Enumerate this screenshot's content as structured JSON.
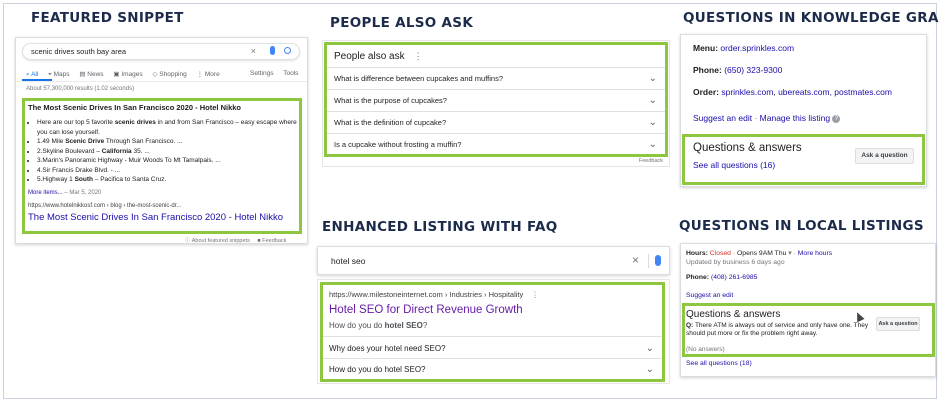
{
  "headings": {
    "featured": "FEATURED SNIPPET",
    "paa": "PEOPLE ALSO ASK",
    "kg": "QUESTIONS IN KNOWLEDGE GRAPH",
    "faq": "ENHANCED LISTING WITH FAQ",
    "local": "QUESTIONS IN LOCAL LISTINGS"
  },
  "featured": {
    "query": "scenic drives south bay area",
    "tabs": [
      "All",
      "Maps",
      "News",
      "Images",
      "Shopping",
      "More"
    ],
    "tools": [
      "Settings",
      "Tools"
    ],
    "results_count": "About 57,300,000 results (1.02 seconds)",
    "snippet_title": "The Most Scenic Drives In San Francisco 2020 - Hotel Nikko",
    "intro": "Here are our top 5 favorite scenic drives in and from San Francisco – easy escape where you can lose yourself.",
    "items": [
      "1.49 Mile Scenic Drive Through San Francisco. ...",
      "2.Skyline Boulevard – California 35. ...",
      "3.Marin's Panoramic Highway - Muir Woods To Mt Tamalpais. ...",
      "4.Sir Francis Drake Blvd. - ...",
      "5.Highway 1 South – Pacifica to Santa Cruz."
    ],
    "more_items": "More items...",
    "date": "Mar 5, 2020",
    "url": "https://www.hotelnikkosf.com › blog › the-most-scenic-dr...",
    "result_title": "The Most Scenic Drives In San Francisco 2020 - Hotel Nikko",
    "about": "About featured snippets",
    "feedback": "Feedback"
  },
  "paa": {
    "title": "People also ask",
    "questions": [
      "What is difference between cupcakes and muffins?",
      "What is the purpose of cupcakes?",
      "What is the definition of cupcake?",
      "Is a cupcake without frosting a muffin?"
    ],
    "feedback": "Feedback"
  },
  "kg": {
    "menu_label": "Menu:",
    "menu_value": "order.sprinkles.com",
    "phone_label": "Phone:",
    "phone_value": "(650) 323-9300",
    "order_label": "Order:",
    "order_links": [
      "sprinkles.com",
      "ubereats.com",
      "postmates.com"
    ],
    "suggest": "Suggest an edit",
    "manage": "Manage this listing",
    "qa_title": "Questions & answers",
    "see_all": "See all questions (16)",
    "ask_button": "Ask a question"
  },
  "faq": {
    "query": "hotel seo",
    "url": "https://www.milestoneinternet.com › Industries › Hospitality",
    "title": "Hotel SEO for Direct Revenue Growth",
    "desc_prefix": "How do you do",
    "desc_bold": "hotel SEO",
    "desc_suffix": "?",
    "questions": [
      "Why does your hotel need SEO?",
      "How do you do hotel SEO?"
    ]
  },
  "local": {
    "hours_label": "Hours:",
    "hours_status": "Closed",
    "hours_opens": "Opens 9AM Thu",
    "more_hours": "More hours",
    "updated": "Updated by business 6 days ago",
    "phone_label": "Phone:",
    "phone_value": "(408) 261-6985",
    "suggest": "Suggest an edit",
    "qa_title": "Questions & answers",
    "q_label": "Q:",
    "question": "There ATM is always out of service and only have one. They should put more or fix the problem right away.",
    "no_answers": "(No answers)",
    "ask_button": "Ask a question",
    "see_all": "See all questions (18)"
  },
  "colors": {
    "accent_green": "#8dc63f",
    "link_blue": "#1a0dab",
    "heading_navy": "#1c2b4a",
    "closed_red": "#d93025"
  }
}
